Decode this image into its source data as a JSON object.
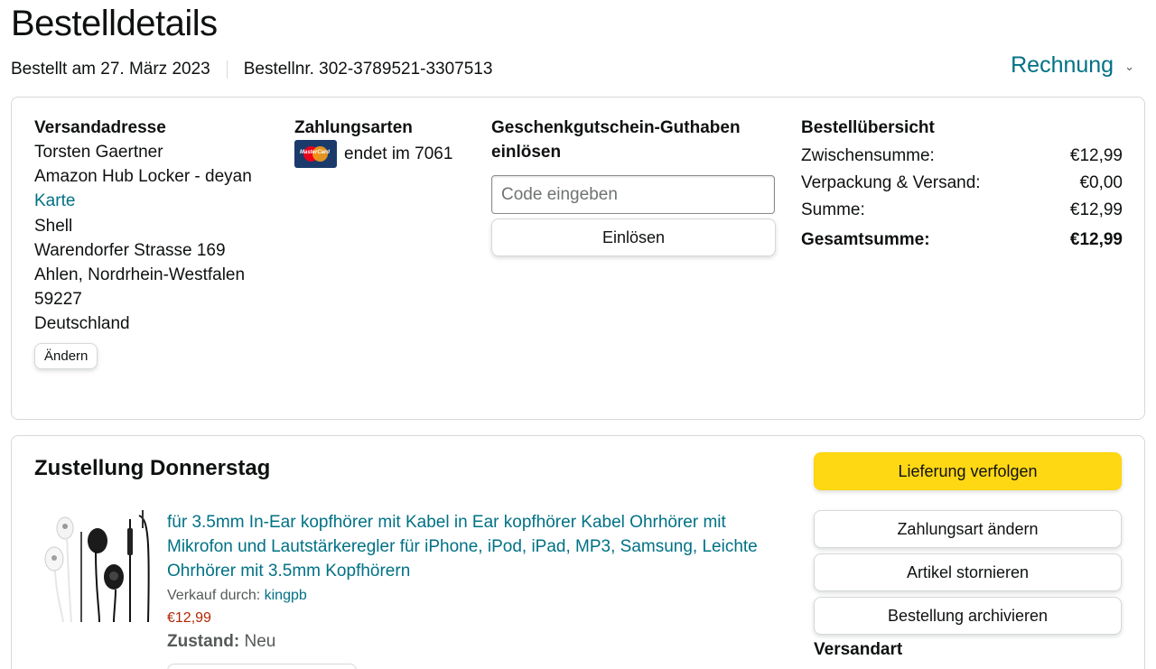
{
  "header": {
    "title": "Bestelldetails",
    "ordered_on": "Bestellt am 27. März 2023",
    "order_number": "Bestellnr. 302-3789521-3307513",
    "invoice_label": "Rechnung"
  },
  "shipping_address": {
    "title": "Versandadresse",
    "name": "Torsten Gaertner",
    "line1": "Amazon Hub Locker - deyan",
    "map_link": "Karte",
    "line2": "Shell",
    "street": "Warendorfer Strasse 169",
    "city": "Ahlen, Nordrhein-Westfalen",
    "zip": "59227",
    "country": "Deutschland",
    "change_label": "Ändern"
  },
  "payment": {
    "title": "Zahlungsarten",
    "card_brand": "MasterCard",
    "card_text": "endet im 7061"
  },
  "gift_card": {
    "title": "Geschenkgutschein-Guthaben einlösen",
    "placeholder": "Code eingeben",
    "redeem_label": "Einlösen"
  },
  "order_summary": {
    "title": "Bestellübersicht",
    "rows": [
      {
        "label": "Zwischensumme:",
        "value": "€12,99"
      },
      {
        "label": "Verpackung & Versand:",
        "value": "€0,00"
      },
      {
        "label": "Summe:",
        "value": "€12,99"
      },
      {
        "label": "Gesamtsumme:",
        "value": "€12,99"
      }
    ]
  },
  "delivery": {
    "title": "Zustellung Donnerstag",
    "product_title": "für 3.5mm In-Ear kopfhörer mit Kabel in Ear kopfhörer Kabel Ohrhörer mit Mikrofon und Lautstärkeregler für iPhone, iPod, iPad, MP3, Samsung, Leichte Ohrhörer mit 3.5mm Kopfhörern",
    "sold_by_label": "Verkauf durch:",
    "seller": "kingpb",
    "price": "€12,99",
    "condition_label": "Zustand:",
    "condition_value": "Neu",
    "actions": {
      "track": "Lieferung verfolgen",
      "change_payment": "Zahlungsart ändern",
      "cancel": "Artikel stornieren",
      "archive": "Bestellung archivieren"
    },
    "shipping_method_label": "Versandart"
  },
  "colors": {
    "link": "#007185",
    "price": "#b12704",
    "primary_button": "#ffd814",
    "border": "#d5d9d9"
  }
}
